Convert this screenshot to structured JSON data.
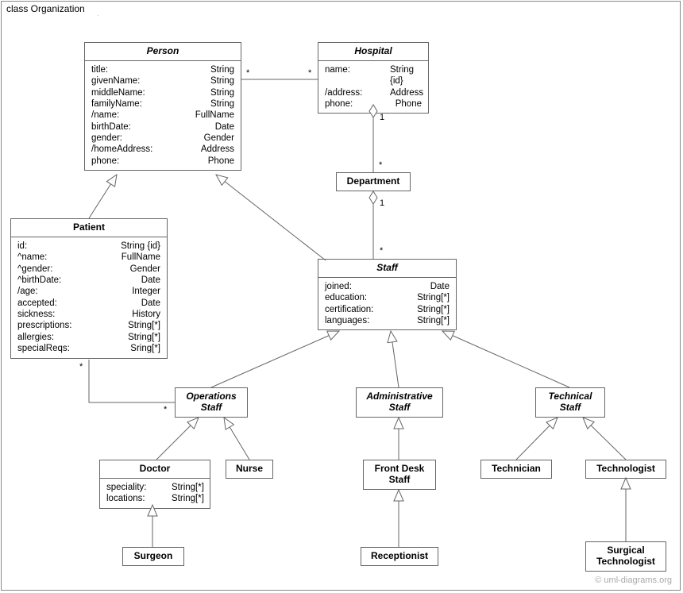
{
  "frame": {
    "title": "class Organization"
  },
  "watermark": "© uml-diagrams.org",
  "classes": {
    "person": {
      "name": "Person",
      "attrs": [
        {
          "n": "title:",
          "t": "String"
        },
        {
          "n": "givenName:",
          "t": "String"
        },
        {
          "n": "middleName:",
          "t": "String"
        },
        {
          "n": "familyName:",
          "t": "String"
        },
        {
          "n": "/name:",
          "t": "FullName"
        },
        {
          "n": "birthDate:",
          "t": "Date"
        },
        {
          "n": "gender:",
          "t": "Gender"
        },
        {
          "n": "/homeAddress:",
          "t": "Address"
        },
        {
          "n": "phone:",
          "t": "Phone"
        }
      ]
    },
    "hospital": {
      "name": "Hospital",
      "attrs": [
        {
          "n": "name:",
          "t": "String {id}"
        },
        {
          "n": "/address:",
          "t": "Address"
        },
        {
          "n": "phone:",
          "t": "Phone"
        }
      ]
    },
    "department": {
      "name": "Department"
    },
    "patient": {
      "name": "Patient",
      "attrs": [
        {
          "n": "id:",
          "t": "String {id}"
        },
        {
          "n": "^name:",
          "t": "FullName"
        },
        {
          "n": "^gender:",
          "t": "Gender"
        },
        {
          "n": "^birthDate:",
          "t": "Date"
        },
        {
          "n": "/age:",
          "t": "Integer"
        },
        {
          "n": "accepted:",
          "t": "Date"
        },
        {
          "n": "sickness:",
          "t": "History"
        },
        {
          "n": "prescriptions:",
          "t": "String[*]"
        },
        {
          "n": "allergies:",
          "t": "String[*]"
        },
        {
          "n": "specialReqs:",
          "t": "Sring[*]"
        }
      ]
    },
    "staff": {
      "name": "Staff",
      "attrs": [
        {
          "n": "joined:",
          "t": "Date"
        },
        {
          "n": "education:",
          "t": "String[*]"
        },
        {
          "n": "certification:",
          "t": "String[*]"
        },
        {
          "n": "languages:",
          "t": "String[*]"
        }
      ]
    },
    "operations": {
      "name": "Operations\nStaff"
    },
    "administrative": {
      "name": "Administrative\nStaff"
    },
    "technical": {
      "name": "Technical\nStaff"
    },
    "doctor": {
      "name": "Doctor",
      "attrs": [
        {
          "n": "speciality:",
          "t": "String[*]"
        },
        {
          "n": "locations:",
          "t": "String[*]"
        }
      ]
    },
    "nurse": {
      "name": "Nurse"
    },
    "frontdesk": {
      "name": "Front Desk\nStaff"
    },
    "technician": {
      "name": "Technician"
    },
    "technologist": {
      "name": "Technologist"
    },
    "surgeon": {
      "name": "Surgeon"
    },
    "receptionist": {
      "name": "Receptionist"
    },
    "surgtech": {
      "name": "Surgical\nTechnologist"
    }
  },
  "mults": {
    "ph_star_l": "*",
    "ph_star_r": "*",
    "hd_one": "1",
    "hd_star": "*",
    "ds_one": "1",
    "ds_star": "*",
    "po_star_top": "*",
    "po_star_bot": "*"
  }
}
